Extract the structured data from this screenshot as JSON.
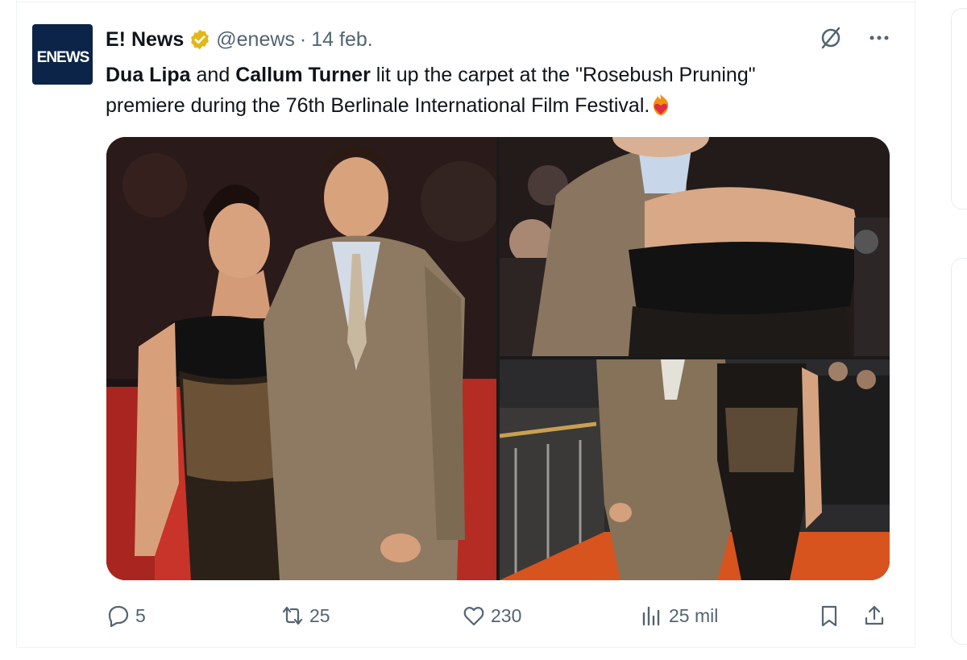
{
  "tweet": {
    "author": {
      "display_name": "E! News",
      "handle": "@enews",
      "date": "14 feb.",
      "avatar_text": "ENEWS",
      "verified_icon": "verified-badge-icon"
    },
    "text": {
      "name1": "Dua Lipa",
      "connector": "and",
      "name2": "Callum Turner",
      "line1_rest": "lit up the carpet at the \"Rosebush Pruning\"",
      "line2": "premiere during the 76th Berlinale International Film Festival.",
      "emoji": "heart-on-fire-emoji"
    },
    "media": [
      {
        "name": "photo-couple-red-carpet"
      },
      {
        "name": "photo-back-closeup"
      },
      {
        "name": "photo-walking-carpet"
      }
    ],
    "actions": {
      "replies": "5",
      "retweets": "25",
      "likes": "230",
      "views": "25 mil"
    }
  },
  "colors": {
    "text_primary": "#0f1419",
    "text_secondary": "#536471",
    "verified_gold": "#e2b719",
    "avatar_bg": "#0b2447",
    "divider": "#eff3f4"
  }
}
